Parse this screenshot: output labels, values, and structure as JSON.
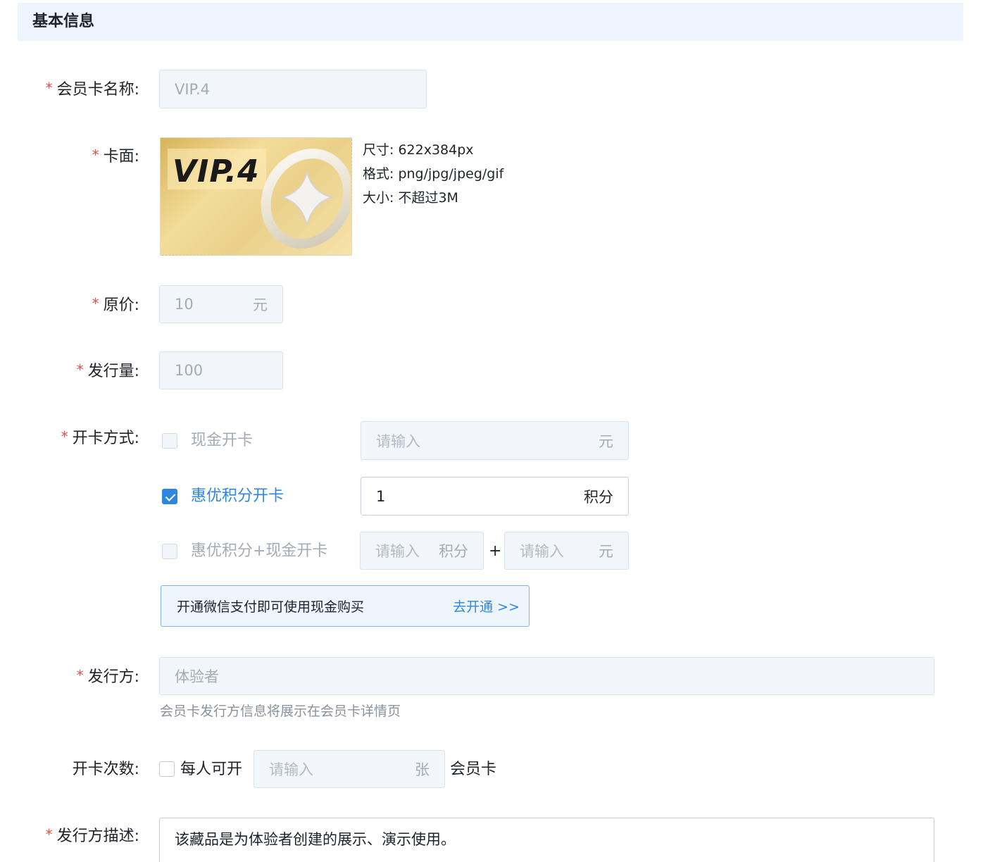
{
  "section": {
    "title": "基本信息"
  },
  "fields": {
    "name": {
      "label": "会员卡名称:",
      "value": "VIP.4"
    },
    "cover": {
      "label": "卡面:",
      "card_text": "VIP.4",
      "specs": [
        "尺寸: 622x384px",
        "格式: png/jpg/jpeg/gif",
        "大小: 不超过3M"
      ]
    },
    "price": {
      "label": "原价:",
      "value": "10",
      "unit": "元"
    },
    "quantity": {
      "label": "发行量:",
      "value": "100"
    },
    "open_method": {
      "label": "开卡方式:",
      "options": [
        {
          "label": "现金开卡",
          "checked": false,
          "placeholder": "请输入",
          "unit": "元"
        },
        {
          "label": "惠优积分开卡",
          "checked": true,
          "value": "1",
          "unit": "积分"
        },
        {
          "label": "惠优积分+现金开卡",
          "checked": false,
          "placeholder_points": "请输入",
          "unit_points": "积分",
          "plus": "+",
          "placeholder_cash": "请输入",
          "unit_cash": "元"
        }
      ],
      "notice": {
        "text": "开通微信支付即可使用现金购买",
        "link": "去开通 >>"
      }
    },
    "issuer": {
      "label": "发行方:",
      "value": "体验者",
      "hint": "会员卡发行方信息将展示在会员卡详情页"
    },
    "limit": {
      "label": "开卡次数:",
      "prefix": "每人可开",
      "placeholder": "请输入",
      "unit": "张",
      "suffix": "会员卡"
    },
    "issuer_desc": {
      "label": "发行方描述:",
      "value": "该藏品是为体验者创建的展示、演示使用。"
    }
  },
  "colors": {
    "accent": "#2e86e0",
    "required": "#f04a3e",
    "header_bg": "#eef4fd"
  }
}
